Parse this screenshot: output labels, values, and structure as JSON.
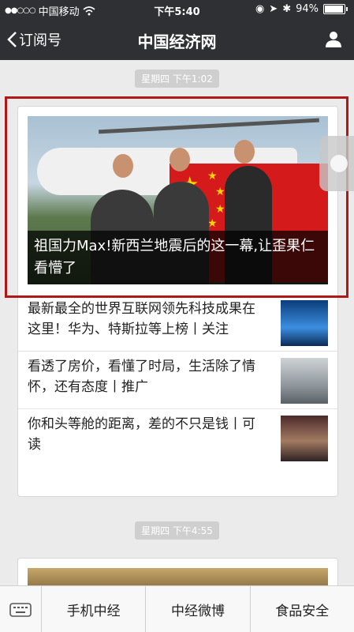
{
  "status": {
    "carrier": "中国移动",
    "time": "下午5:40",
    "battery": "94%"
  },
  "nav": {
    "back_label": "订阅号",
    "title": "中国经济网"
  },
  "feed": [
    {
      "timestamp": "星期四 下午1:02",
      "hero_title": "祖国力Max!新西兰地震后的这一幕,让歪果仁看懵了",
      "items": [
        {
          "title": "最新最全的世界互联网领先科技成果在这里！华为、特斯拉等上榜丨关注"
        },
        {
          "title": "看透了房价，看懂了时局，生活除了情怀，还有态度丨推广"
        },
        {
          "title": "你和头等舱的距离，差的不只是钱丨可读"
        }
      ]
    },
    {
      "timestamp": "星期四 下午4:55"
    }
  ],
  "bottom_menu": [
    "手机中经",
    "中经微博",
    "食品安全"
  ],
  "colors": {
    "navbar": "#2e3033",
    "highlight": "#b01818",
    "background": "#ebebeb"
  },
  "icons": {
    "wifi": "wifi-icon",
    "location": "location-icon",
    "bluetooth": "bluetooth-icon",
    "profile": "person-icon",
    "keyboard": "keyboard-icon"
  }
}
